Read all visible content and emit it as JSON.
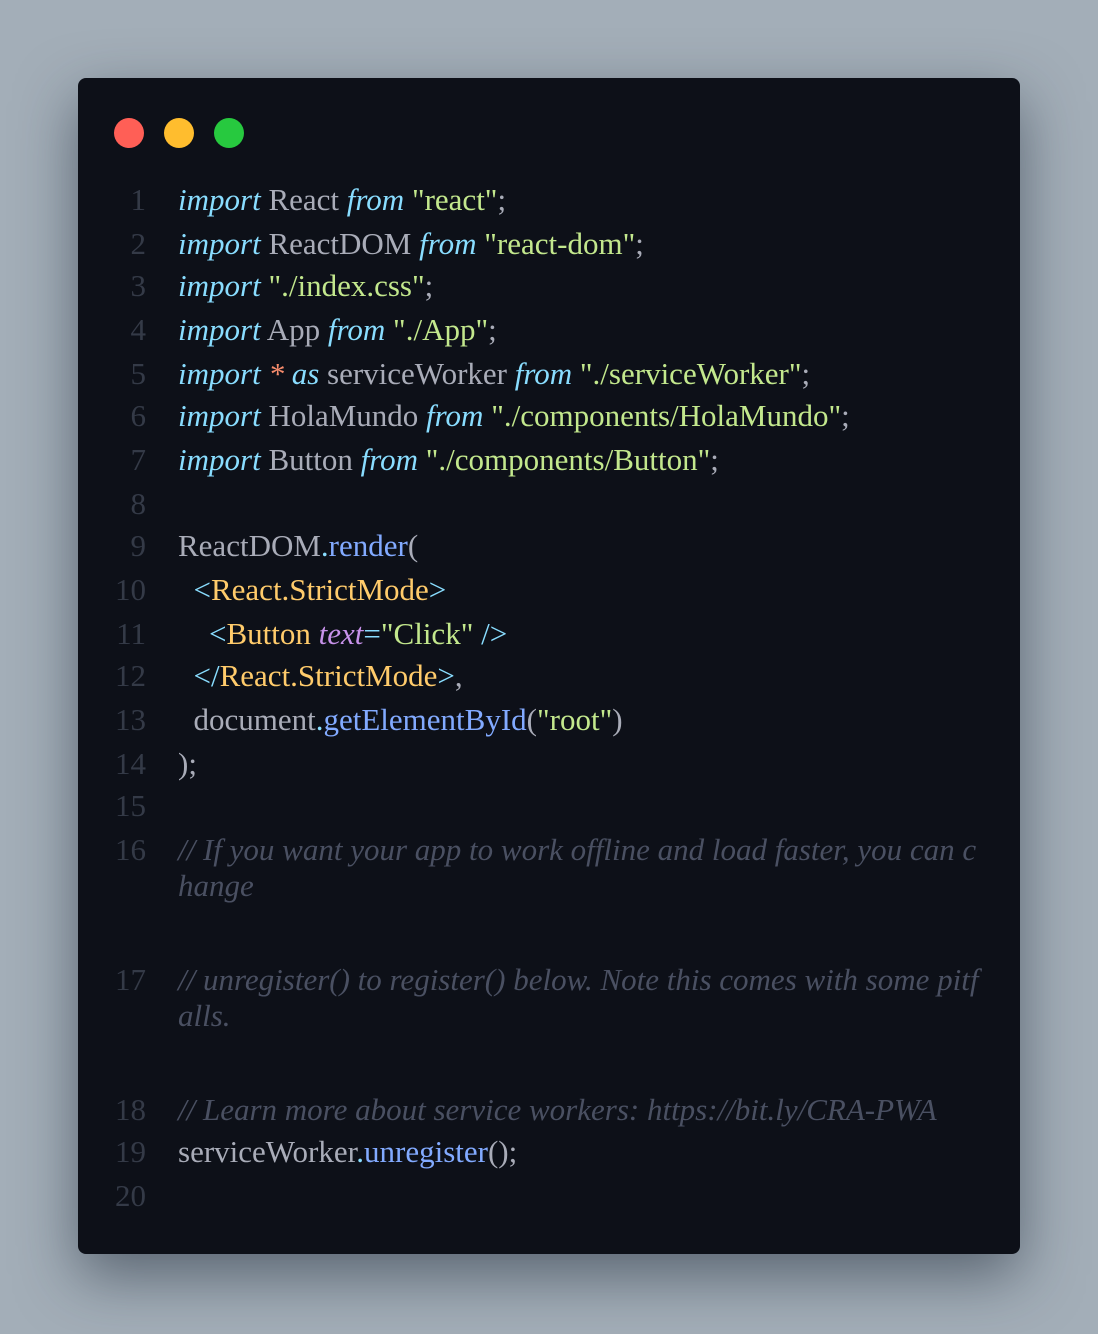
{
  "window": {
    "buttons": [
      "close",
      "minimize",
      "maximize"
    ],
    "colors": {
      "background": "#a3aeb8",
      "editor": "#0d1018",
      "close": "#ff5f56",
      "minimize": "#ffbd2e",
      "maximize": "#27c93f"
    }
  },
  "theme": {
    "keyword": "#89ddff",
    "string": "#c3e88d",
    "function": "#82aaff",
    "tag": "#ffcb6b",
    "attribute": "#c792ea",
    "operator": "#f78c6c",
    "comment": "#4a5062",
    "plain": "#a9acb8",
    "line_number": "#343a47"
  },
  "lines": [
    {
      "n": "1",
      "tokens": [
        [
          "kw",
          "import"
        ],
        [
          "pl",
          " React "
        ],
        [
          "kw",
          "from"
        ],
        [
          "pl",
          " "
        ],
        [
          "str",
          "\"react\""
        ],
        [
          "pl",
          ";"
        ]
      ]
    },
    {
      "n": "2",
      "tokens": [
        [
          "kw",
          "import"
        ],
        [
          "pl",
          " ReactDOM "
        ],
        [
          "kw",
          "from"
        ],
        [
          "pl",
          " "
        ],
        [
          "str",
          "\"react-dom\""
        ],
        [
          "pl",
          ";"
        ]
      ]
    },
    {
      "n": "3",
      "tokens": [
        [
          "kw",
          "import"
        ],
        [
          "pl",
          " "
        ],
        [
          "str",
          "\"./index.css\""
        ],
        [
          "pl",
          ";"
        ]
      ]
    },
    {
      "n": "4",
      "tokens": [
        [
          "kw",
          "import"
        ],
        [
          "pl",
          " App "
        ],
        [
          "kw",
          "from"
        ],
        [
          "pl",
          " "
        ],
        [
          "str",
          "\"./App\""
        ],
        [
          "pl",
          ";"
        ]
      ]
    },
    {
      "n": "5",
      "tokens": [
        [
          "kw",
          "import"
        ],
        [
          "pl",
          " "
        ],
        [
          "star",
          "*"
        ],
        [
          "pl",
          " "
        ],
        [
          "kw",
          "as"
        ],
        [
          "pl",
          " serviceWorker "
        ],
        [
          "kw",
          "from"
        ],
        [
          "pl",
          " "
        ],
        [
          "str",
          "\"./serviceWorker\""
        ],
        [
          "pl",
          ";"
        ]
      ]
    },
    {
      "n": "6",
      "tokens": [
        [
          "kw",
          "import"
        ],
        [
          "pl",
          " HolaMundo "
        ],
        [
          "kw",
          "from"
        ],
        [
          "pl",
          " "
        ],
        [
          "str",
          "\"./components/HolaMundo\""
        ],
        [
          "pl",
          ";"
        ]
      ]
    },
    {
      "n": "7",
      "tokens": [
        [
          "kw",
          "import"
        ],
        [
          "pl",
          " Button "
        ],
        [
          "kw",
          "from"
        ],
        [
          "pl",
          " "
        ],
        [
          "str",
          "\"./components/Button\""
        ],
        [
          "pl",
          ";"
        ]
      ]
    },
    {
      "n": "8",
      "tokens": []
    },
    {
      "n": "9",
      "tokens": [
        [
          "pl",
          "ReactDOM"
        ],
        [
          "brk",
          "."
        ],
        [
          "fn",
          "render"
        ],
        [
          "pl",
          "("
        ]
      ]
    },
    {
      "n": "10",
      "tokens": [
        [
          "pl",
          "  "
        ],
        [
          "brk",
          "<"
        ],
        [
          "tag",
          "React.StrictMode"
        ],
        [
          "brk",
          ">"
        ]
      ]
    },
    {
      "n": "11",
      "tokens": [
        [
          "pl",
          "    "
        ],
        [
          "brk",
          "<"
        ],
        [
          "tag",
          "Button"
        ],
        [
          "pl",
          " "
        ],
        [
          "attr",
          "text"
        ],
        [
          "brk",
          "="
        ],
        [
          "str",
          "\"Click\""
        ],
        [
          "pl",
          " "
        ],
        [
          "brk",
          "/>"
        ]
      ]
    },
    {
      "n": "12",
      "tokens": [
        [
          "pl",
          "  "
        ],
        [
          "brk",
          "</"
        ],
        [
          "tag",
          "React.StrictMode"
        ],
        [
          "brk",
          ">"
        ],
        [
          "pl",
          ","
        ]
      ]
    },
    {
      "n": "13",
      "tokens": [
        [
          "pl",
          "  document"
        ],
        [
          "brk",
          "."
        ],
        [
          "fn",
          "getElementById"
        ],
        [
          "pl",
          "("
        ],
        [
          "str",
          "\"root\""
        ],
        [
          "pl",
          ")"
        ]
      ]
    },
    {
      "n": "14",
      "tokens": [
        [
          "pl",
          ");"
        ]
      ]
    },
    {
      "n": "15",
      "tokens": []
    },
    {
      "n": "16",
      "wrap": true,
      "tokens": [
        [
          "cm",
          "// If you want your app to work offline and load faster, you can change"
        ]
      ]
    },
    {
      "n": "17",
      "wrap": true,
      "tokens": [
        [
          "cm",
          "// unregister() to register() below. Note this comes with some pitfalls."
        ]
      ]
    },
    {
      "n": "18",
      "tokens": [
        [
          "cm",
          "// Learn more about service workers: https://bit.ly/CRA-PWA"
        ]
      ]
    },
    {
      "n": "19",
      "tokens": [
        [
          "pl",
          "serviceWorker"
        ],
        [
          "brk",
          "."
        ],
        [
          "fn",
          "unregister"
        ],
        [
          "pl",
          "();"
        ]
      ]
    },
    {
      "n": "20",
      "tokens": []
    }
  ]
}
